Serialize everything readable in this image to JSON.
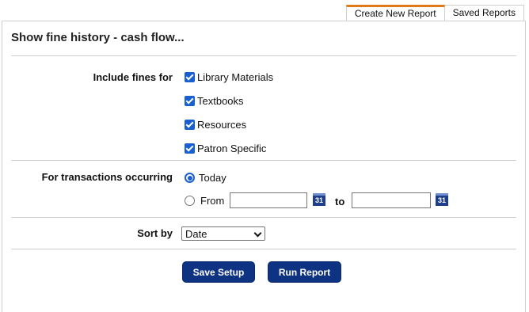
{
  "tabs": [
    {
      "label": "Create New Report",
      "active": true
    },
    {
      "label": "Saved Reports",
      "active": false
    }
  ],
  "title": "Show fine history - cash flow...",
  "include_fines": {
    "label": "Include fines for",
    "options": [
      {
        "label": "Library Materials",
        "checked": true
      },
      {
        "label": "Textbooks",
        "checked": true
      },
      {
        "label": "Resources",
        "checked": true
      },
      {
        "label": "Patron Specific",
        "checked": true
      }
    ]
  },
  "transactions": {
    "label": "For transactions occurring",
    "today_label": "Today",
    "today_selected": true,
    "from_label": "From",
    "to_label": "to",
    "from_value": "",
    "to_value": "",
    "calendar_glyph": "31"
  },
  "sort": {
    "label": "Sort by",
    "selected": "Date"
  },
  "buttons": {
    "save": "Save Setup",
    "run": "Run Report"
  },
  "colors": {
    "accent_tab": "#e07b1a",
    "button_bg": "#0d3382",
    "checkbox": "#1a5fd0"
  }
}
